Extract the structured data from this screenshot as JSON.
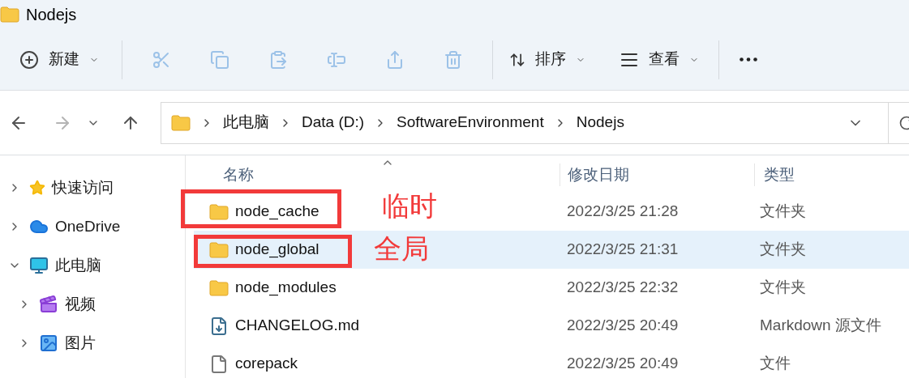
{
  "window": {
    "title": "Nodejs"
  },
  "toolbar": {
    "new_button": {
      "label": "新建"
    },
    "actions": [
      {
        "kind": "cut",
        "disabled": true
      },
      {
        "kind": "copy",
        "disabled": true
      },
      {
        "kind": "paste",
        "disabled": true
      },
      {
        "kind": "rename",
        "disabled": true
      },
      {
        "kind": "share",
        "disabled": true
      },
      {
        "kind": "delete",
        "disabled": true
      }
    ],
    "sort_button": {
      "label": "排序"
    },
    "view_button": {
      "label": "查看"
    }
  },
  "navigation": {
    "back": {
      "disabled": false
    },
    "forward": {
      "disabled": true
    }
  },
  "address_bar": {
    "breadcrumbs": [
      "此电脑",
      "Data (D:)",
      "SoftwareEnvironment",
      "Nodejs"
    ]
  },
  "sidebar": {
    "items": [
      {
        "label": "快速访问",
        "kind": "star",
        "expanded": false
      },
      {
        "label": "OneDrive",
        "kind": "cloud",
        "expanded": false
      },
      {
        "label": "此电脑",
        "kind": "computer",
        "expanded": true,
        "children": [
          {
            "label": "视频",
            "kind": "video",
            "expanded": false
          },
          {
            "label": "图片",
            "kind": "image",
            "expanded": false
          }
        ]
      }
    ]
  },
  "table": {
    "columns": [
      "名称",
      "修改日期",
      "类型"
    ],
    "rows": [
      {
        "name": "node_cache",
        "date": "2022/3/25 21:28",
        "type": "文件夹",
        "kind": "folder",
        "selected": false,
        "annotation": "临时"
      },
      {
        "name": "node_global",
        "date": "2022/3/25 21:31",
        "type": "文件夹",
        "kind": "folder",
        "selected": true,
        "annotation": "全局"
      },
      {
        "name": "node_modules",
        "date": "2022/3/25 22:32",
        "type": "文件夹",
        "kind": "folder",
        "selected": false
      },
      {
        "name": "CHANGELOG.md",
        "date": "2022/3/25 20:49",
        "type": "Markdown 源文件",
        "kind": "markdown",
        "selected": false
      },
      {
        "name": "corepack",
        "date": "2022/3/25 20:49",
        "type": "文件",
        "kind": "file",
        "selected": false
      }
    ]
  }
}
